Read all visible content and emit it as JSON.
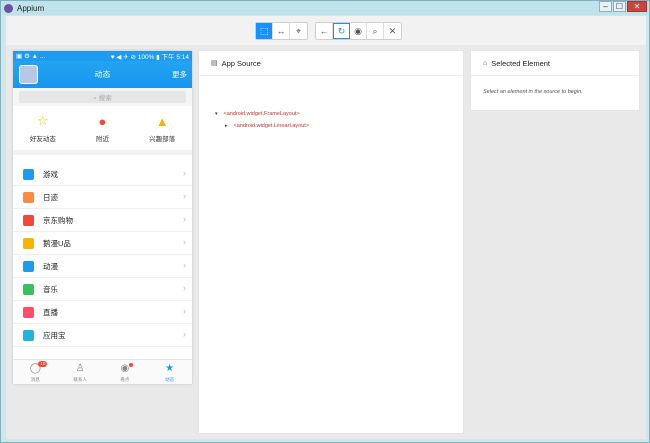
{
  "window": {
    "title": "Appium",
    "controls": [
      "–",
      "☐",
      "✕"
    ]
  },
  "toolbar": {
    "group1": [
      {
        "name": "select-element-icon",
        "glyph": "⬚",
        "active": true
      },
      {
        "name": "swipe-icon",
        "glyph": "↔",
        "active": false
      },
      {
        "name": "tap-by-coordinates-icon",
        "glyph": "⌖",
        "active": false
      }
    ],
    "group2": [
      {
        "name": "back-icon",
        "glyph": "←"
      },
      {
        "name": "refresh-icon",
        "glyph": "↻"
      },
      {
        "name": "eye-icon",
        "glyph": "◉"
      },
      {
        "name": "search-icon",
        "glyph": "⌕"
      },
      {
        "name": "close-icon",
        "glyph": "✕"
      }
    ]
  },
  "phone": {
    "status": {
      "left": "▣ ⚙ ▲ ...",
      "right": "♥ ◀ ✈ ⊘ 100% ▮ 下午 5:14"
    },
    "header": {
      "title": "动态",
      "more": "更多"
    },
    "search": {
      "placeholder": "⌕ 搜索"
    },
    "shortcuts": [
      {
        "label": "好友动态",
        "icon": "star-icon",
        "glyph": "☆",
        "color": "#f4b400"
      },
      {
        "label": "附近",
        "icon": "location-pin-icon",
        "glyph": "●",
        "color": "#f4473b"
      },
      {
        "label": "兴趣部落",
        "icon": "tribe-icon",
        "glyph": "▲",
        "color": "#f4b400"
      }
    ],
    "list": [
      {
        "label": "游戏",
        "icon": "gamepad-icon",
        "color": "#1d9bf0"
      },
      {
        "label": "日迹",
        "icon": "daily-icon",
        "color": "#ff8a3d"
      },
      {
        "label": "京东购物",
        "icon": "jd-icon",
        "color": "#f4473b"
      },
      {
        "label": "鹅漫U品",
        "icon": "gift-icon",
        "color": "#f7b500"
      },
      {
        "label": "动漫",
        "icon": "anime-icon",
        "color": "#1d9bf0"
      },
      {
        "label": "音乐",
        "icon": "music-icon",
        "color": "#36c25a"
      },
      {
        "label": "直播",
        "icon": "live-icon",
        "color": "#ff4d6a"
      },
      {
        "label": "应用宝",
        "icon": "appstore-icon",
        "color": "#21b3e0"
      }
    ],
    "tabs": [
      {
        "label": "消息",
        "icon": "message-icon",
        "glyph": "◯",
        "badge": "10"
      },
      {
        "label": "联系人",
        "icon": "contacts-icon",
        "glyph": "♙",
        "badge": ""
      },
      {
        "label": "看点",
        "icon": "eye-tab-icon",
        "glyph": "◉",
        "badge": "dot"
      },
      {
        "label": "动态",
        "icon": "star-tab-icon",
        "glyph": "★",
        "badge": "",
        "active": true
      }
    ]
  },
  "source_panel": {
    "title": "App Source",
    "nodes": [
      {
        "toggle": "▾",
        "text": "<android.widget.FrameLayout>"
      },
      {
        "toggle": "▸",
        "text": "<android.widget.LinearLayout>"
      }
    ]
  },
  "selected_panel": {
    "title": "Selected Element",
    "hint": "Select an element in the source to begin."
  }
}
